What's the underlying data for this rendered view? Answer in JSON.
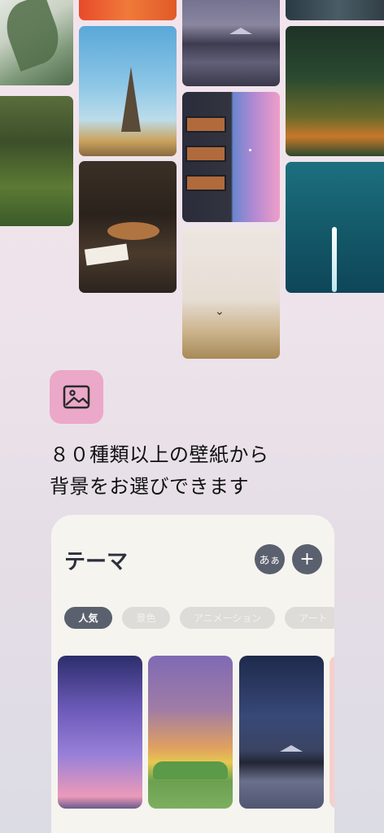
{
  "collage": {
    "tiles": [
      "plant",
      "forest",
      "orange-abstract",
      "eiffel-tower",
      "cafe",
      "mountain-lake",
      "building-dusk",
      "desert-bird",
      "rock-cliff",
      "autumn-trees",
      "ocean-boat"
    ]
  },
  "feature": {
    "icon": "image-icon",
    "line1": "８０種類以上の壁紙から",
    "line2": "背景をお選びできます"
  },
  "card": {
    "title": "テーマ",
    "font_button": "あぁ",
    "add_button": "+",
    "chips": [
      {
        "label": "人気",
        "active": true
      },
      {
        "label": "景色",
        "active": false
      },
      {
        "label": "アニメーション",
        "active": false
      },
      {
        "label": "アート",
        "active": false
      }
    ],
    "wallpapers": [
      "galaxy",
      "sunset-meadow",
      "night-mountain-lake"
    ]
  },
  "colors": {
    "accent_pink": "#eba8c9",
    "button_dark": "#5a606e",
    "card_bg": "#f6f4ef"
  }
}
